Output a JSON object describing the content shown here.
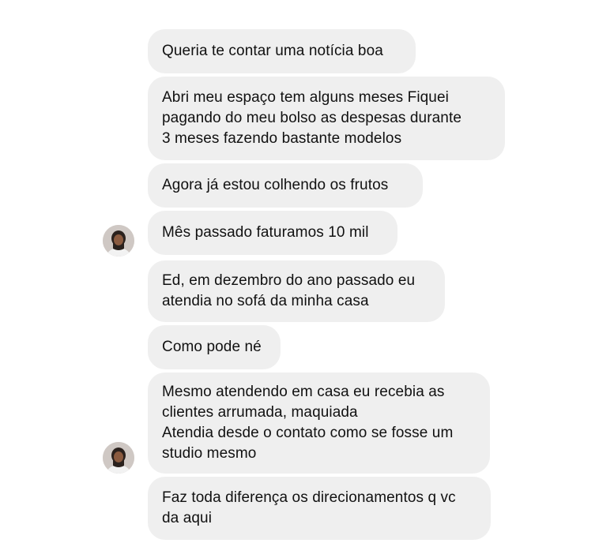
{
  "conversation": {
    "messages": [
      {
        "text": "Queria te contar uma notícia boa"
      },
      {
        "text": "Abri meu espaço tem alguns meses Fiquei\npagando do meu bolso as despesas durante\n3 meses fazendo bastante modelos"
      },
      {
        "text": "Agora já estou colhendo os frutos"
      },
      {
        "text": "Mês passado faturamos 10 mil"
      },
      {
        "text": "Ed, em dezembro do ano passado eu\natendia no sofá da minha casa"
      },
      {
        "text": "Como pode né"
      },
      {
        "text": "Mesmo atendendo em casa eu recebia as\nclientes arrumada, maquiada\nAtendia desde o contato como se fosse um\nstudio mesmo"
      },
      {
        "text": "Faz toda diferença os direcionamentos q vc\nda aqui"
      }
    ]
  },
  "colors": {
    "bubble_background": "#efefef",
    "text": "#111111"
  },
  "icons": {
    "avatar": "contact-avatar-icon"
  }
}
